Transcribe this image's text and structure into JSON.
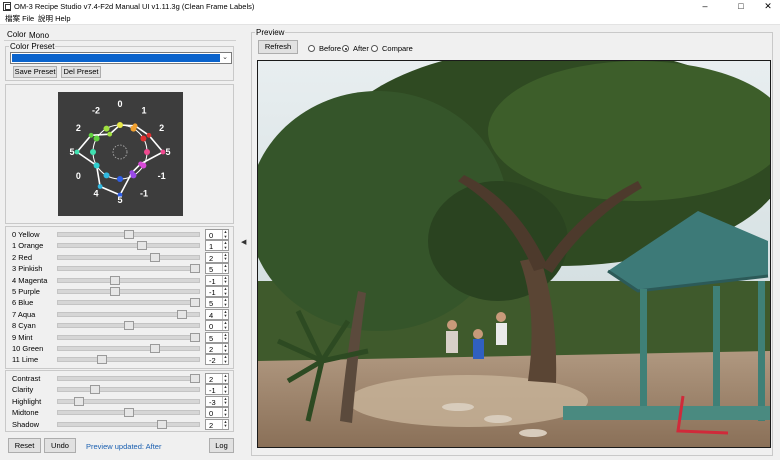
{
  "window": {
    "title": "OM-3 Recipe Studio v7.4-F2d Manual UI v1.11.3g (Clean Frame Labels)"
  },
  "menu": {
    "items": [
      "檔案 File",
      "說明 Help"
    ]
  },
  "tabs": [
    "Color",
    "Mono"
  ],
  "preset": {
    "group_label": "Color Preset",
    "save_label": "Save Preset",
    "delete_label": "Del Preset"
  },
  "wheel": {
    "labels": [
      "0",
      "1",
      "2",
      "5",
      "-1",
      "-1",
      "5",
      "4",
      "0",
      "5",
      "2",
      "-2"
    ],
    "colors": [
      "#e8e84a",
      "#f0a030",
      "#e03030",
      "#f04a90",
      "#d84ad8",
      "#9a4ae8",
      "#3060e8",
      "#30b8e0",
      "#30d0d0",
      "#40e0b0",
      "#60d040",
      "#a0e040"
    ]
  },
  "sliders": [
    {
      "label": "0  Yellow",
      "value": 0,
      "min": -5,
      "max": 5
    },
    {
      "label": "1  Orange",
      "value": 1,
      "min": -5,
      "max": 5
    },
    {
      "label": "2  Red",
      "value": 2,
      "min": -5,
      "max": 5
    },
    {
      "label": "3  Pinkish",
      "value": 5,
      "min": -5,
      "max": 5
    },
    {
      "label": "4  Magenta",
      "value": -1,
      "min": -5,
      "max": 5
    },
    {
      "label": "5  Purple",
      "value": -1,
      "min": -5,
      "max": 5
    },
    {
      "label": "6  Blue",
      "value": 5,
      "min": -5,
      "max": 5
    },
    {
      "label": "7  Aqua",
      "value": 4,
      "min": -5,
      "max": 5
    },
    {
      "label": "8  Cyan",
      "value": 0,
      "min": -5,
      "max": 5
    },
    {
      "label": "9  Mint",
      "value": 5,
      "min": -5,
      "max": 5
    },
    {
      "label": "10  Green",
      "value": 2,
      "min": -5,
      "max": 5
    },
    {
      "label": "11  Lime",
      "value": -2,
      "min": -5,
      "max": 5
    }
  ],
  "tone_sliders": [
    {
      "label": "Contrast",
      "value": 2,
      "min": -2,
      "max": 2
    },
    {
      "label": "Clarity",
      "value": -1,
      "min": -2,
      "max": 2
    },
    {
      "label": "Highlight",
      "value": -3,
      "min": -4,
      "max": 4
    },
    {
      "label": "Midtone",
      "value": 0,
      "min": -2,
      "max": 2
    },
    {
      "label": "Shadow",
      "value": 2,
      "min": -4,
      "max": 4
    }
  ],
  "footer": {
    "reset_label": "Reset",
    "undo_label": "Undo",
    "status_text": "Preview updated: After",
    "log_label": "Log"
  },
  "preview": {
    "group_label": "Preview",
    "refresh_label": "Refresh",
    "modes": [
      "Before",
      "After",
      "Compare"
    ],
    "selected_mode": "After"
  }
}
